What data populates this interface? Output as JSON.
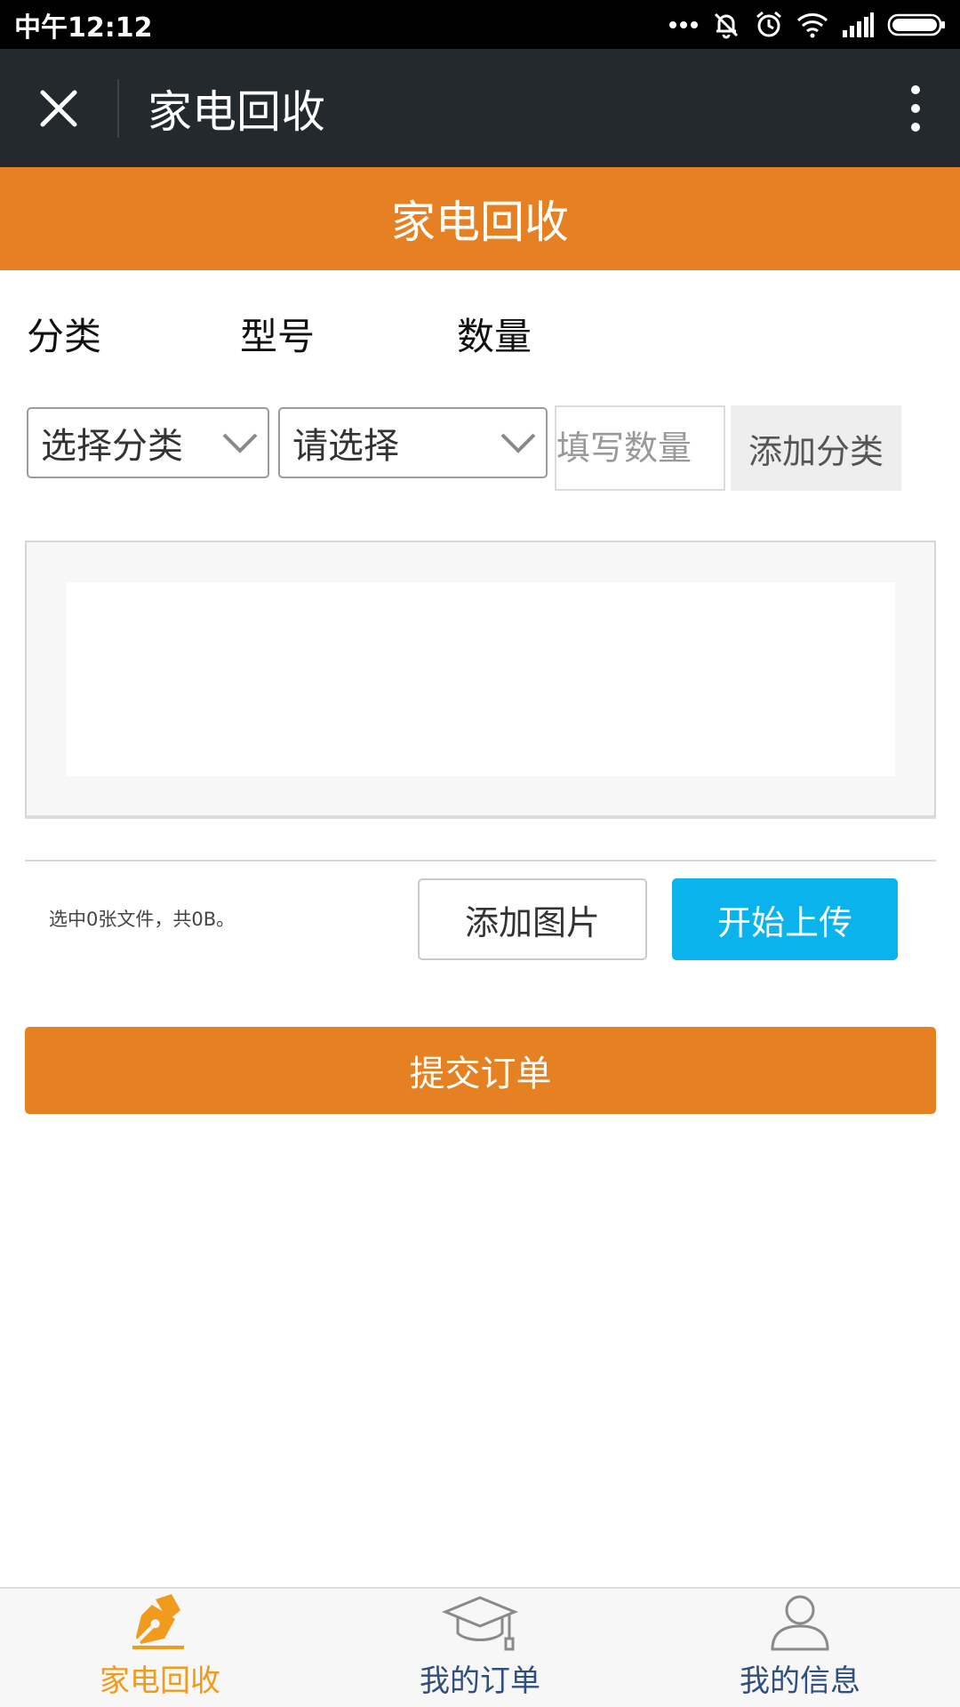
{
  "status_bar": {
    "time": "中午12:12"
  },
  "app_bar": {
    "title": "家电回收",
    "close_icon": "close-icon",
    "more_icon": "more-vert-icon"
  },
  "header": {
    "title": "家电回收"
  },
  "form": {
    "labels": {
      "category": "分类",
      "model": "型号",
      "quantity": "数量"
    },
    "category_select": {
      "value": "选择分类"
    },
    "model_select": {
      "value": "请选择"
    },
    "quantity_input": {
      "placeholder": "填写数量",
      "value": ""
    },
    "add_category_label": "添加分类"
  },
  "upload": {
    "file_info": "选中0张文件，共0B。",
    "add_image_label": "添加图片",
    "start_upload_label": "开始上传"
  },
  "submit_label": "提交订单",
  "bottom_nav": {
    "items": [
      {
        "label": "家电回收",
        "icon": "pen-nib-icon",
        "active": true
      },
      {
        "label": "我的订单",
        "icon": "graduation-cap-icon",
        "active": false
      },
      {
        "label": "我的信息",
        "icon": "user-icon",
        "active": false
      }
    ]
  },
  "colors": {
    "accent_orange": "#e68123",
    "upload_blue": "#0ab3ec",
    "app_bar": "#23292c",
    "nav_active": "#f09b1c",
    "nav_inactive": "#2f4f7f"
  }
}
